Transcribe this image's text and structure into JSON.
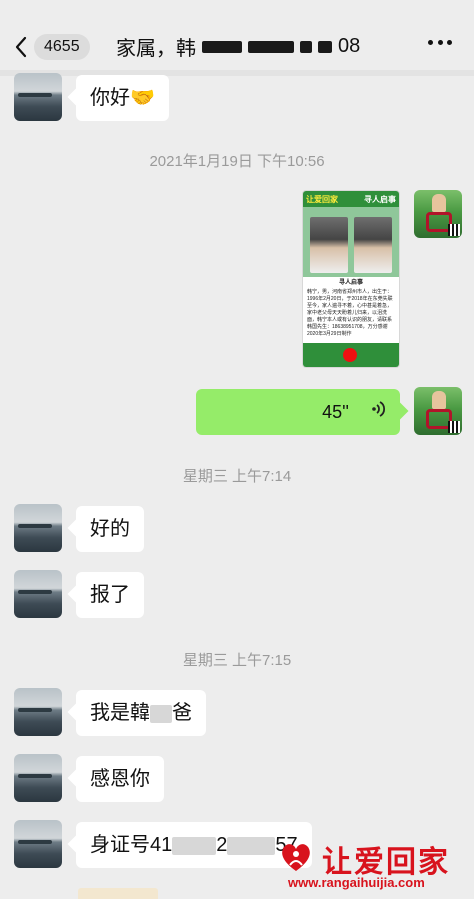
{
  "header": {
    "unread_count": "4655",
    "title_prefix": "家属，韩",
    "title_suffix": "08"
  },
  "messages": {
    "greeting": "你好🤝",
    "timestamp_1": "2021年1月19日 下午10:56",
    "poster": {
      "top_left": "让爱回家",
      "top_right": "寻人启事",
      "heading": "寻人启事",
      "body": "韩宁，男，河南省郑州市人，出生于：1996年2月20日，于2018年在东莞失联至今，家人遍寻不着，心中甚是着急，家中老父母天天盼着儿归来，以泪洗面，韩宁本人或有认识的朋友，请联系韩国先生：18638951708，万分感谢 2020年3月29日制作"
    },
    "voice_duration": "45''",
    "timestamp_2": "星期三 上午7:14",
    "reply_ok": "好的",
    "reply_reported": "报了",
    "timestamp_3": "星期三 上午7:15",
    "im_prefix": "我是韓",
    "im_suffix": "爸",
    "thanks": "感恩你",
    "id_prefix": "身证号41",
    "id_mid": "2",
    "id_suffix": "57"
  },
  "watermark": {
    "title": "让爱回家",
    "url": "www.rangaihuijia.com"
  },
  "colors": {
    "background": "#ededed",
    "bubble_self": "#95ec69",
    "bubble_other": "#ffffff",
    "timestamp": "#9a9a9a",
    "watermark": "#d8131d"
  }
}
